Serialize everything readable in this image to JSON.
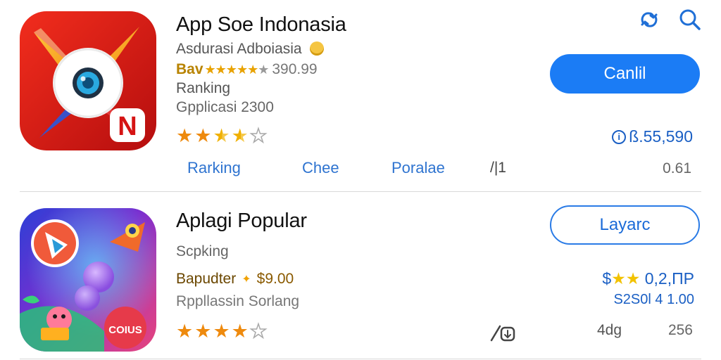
{
  "header": {
    "icons": [
      "refresh-icon",
      "search-icon"
    ]
  },
  "apps": [
    {
      "title": "App Soe Indonasia",
      "developer": "Asdurasi Adboiasia",
      "rating_line_lead": "Bav",
      "rating_line_value": "390.99",
      "category": "Ranking",
      "meta": "Gpplicasi 2300",
      "stars": 3.5,
      "button_label": "Canlil",
      "price": "ß.55,590",
      "tabs": [
        "Rarking",
        "Chee",
        "Poralae"
      ],
      "tab_extra": "/|1",
      "tab_right": "0.61",
      "icon_badge": "N",
      "accent": "#d81a1a"
    },
    {
      "title": "Aplagi Popular",
      "category": "Scpking",
      "price_line_lead": "Bapudter",
      "price_line_value": "$9.00",
      "meta": "Rppllassin Sorlang",
      "stars": 4,
      "button_label": "Layarc",
      "price_a_prefix": "$",
      "price_a_value": "0,2,ПР",
      "price_b": "S2S0l 4 1.00",
      "foot_a": "4dg",
      "foot_b": "256",
      "icon_badge": "COIUS",
      "accent": "#1b7cf5"
    }
  ]
}
